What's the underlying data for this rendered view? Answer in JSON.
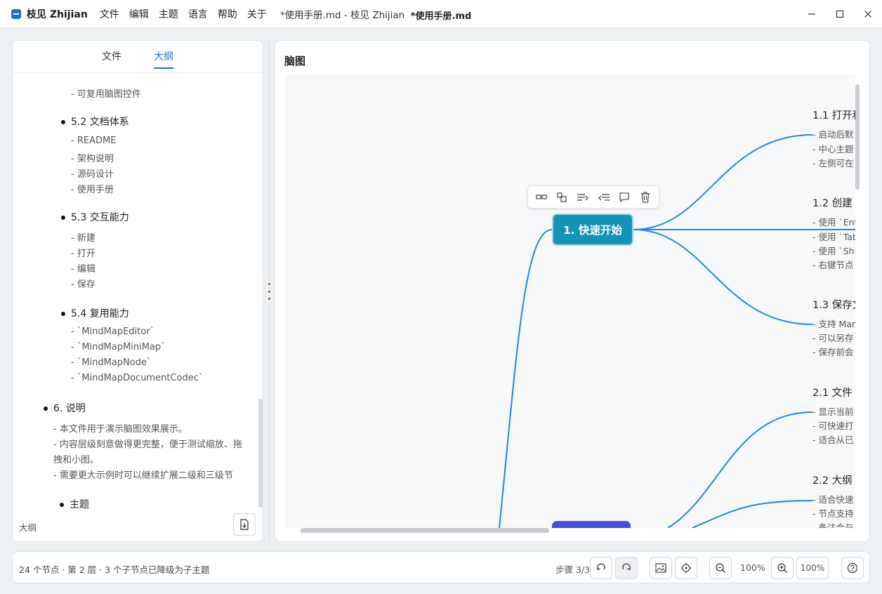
{
  "titlebar": {
    "app_name": "枝见 Zhijian",
    "menu": [
      "文件",
      "编辑",
      "主题",
      "语言",
      "帮助",
      "关于"
    ],
    "window_title": "*使用手册.md - 枝见 Zhijian",
    "center_title": "*使用手册.md",
    "controls": {
      "minimize": "—",
      "maximize": "☐",
      "close": "✕"
    }
  },
  "left_panel": {
    "tabs": [
      {
        "label": "文件",
        "active": false
      },
      {
        "label": "大纲",
        "active": true
      }
    ],
    "outline": {
      "top_line": "- 可复用脑图控件",
      "sections": [
        {
          "heading": "5.2 文档体系",
          "items": [
            "- README",
            "- 架构说明",
            "- 源码设计",
            "- 使用手册"
          ]
        },
        {
          "heading": "5.3 交互能力",
          "items": [
            "- 新建",
            "- 打开",
            "- 编辑",
            "- 保存"
          ]
        },
        {
          "heading": "5.4 复用能力",
          "items": [
            "- `MindMapEditor`",
            "- `MindMapMiniMap`",
            "- `MindMapNode`",
            "- `MindMapDocumentCodec`"
          ]
        }
      ],
      "section6": {
        "heading": "6. 说明",
        "items": [
          "- 本文件用于演示脑图效果展示。",
          "- 内容层级刻意做得更完整，便于测试缩放、拖",
          "拽和小图。",
          "- 需要更大示例时可以继续扩展二级和三级节"
        ]
      },
      "last_heading": "主题"
    },
    "footer_label": "大纲"
  },
  "right_panel": {
    "title": "脑图",
    "root_node": "1. 快速开始",
    "branches": [
      {
        "title": "1.1 打开和",
        "leaves": [
          "- 启动后默",
          "- 中心主题",
          "- 左侧可在"
        ]
      },
      {
        "title": "1.2 创建",
        "leaves": [
          "- 使用 `Ent",
          "- 使用 `Tab",
          "- 使用 `Shi",
          "- 右键节点"
        ]
      },
      {
        "title": "1.3 保存文",
        "leaves": [
          "- 支持 Mar",
          "- 可以另存",
          "- 保存前会"
        ]
      },
      {
        "title": "2.1 文件",
        "leaves": [
          "- 显示当前",
          "- 可快速打",
          "- 适合从已"
        ]
      },
      {
        "title": "2.2 大纲",
        "leaves": [
          "- 适合快速",
          "- 节点支持",
          "- 备注会与"
        ]
      }
    ],
    "colors": {
      "link": "#1f86e8",
      "root": "#1593b6",
      "root2": "#4a4fd9"
    }
  },
  "status": {
    "info": "24 个节点 · 第 2 层 · 3 个子节点",
    "message": "已降级为子主题",
    "step": "步骤 3/3",
    "zoom_label": "100%",
    "minimap_zoom": "100%"
  }
}
